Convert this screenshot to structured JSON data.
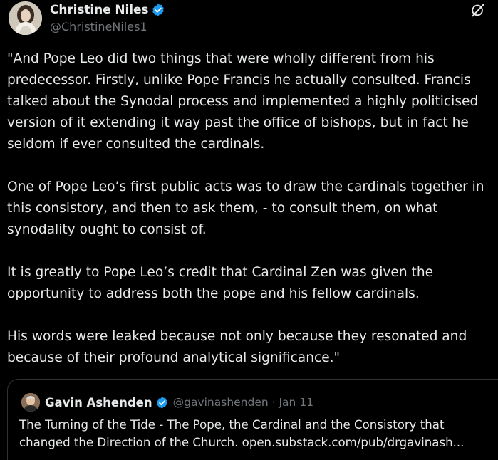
{
  "author": {
    "display_name": "Christine Niles",
    "handle": "@ChristineNiles1",
    "verified_icon": "verified-badge-icon",
    "avatar_icon": "avatar"
  },
  "toolbar": {
    "grok_icon": "grok-icon"
  },
  "tweet": {
    "text": "\"And Pope Leo did two things that were wholly different from his predecessor. Firstly, unlike Pope Francis he actually consulted. Francis talked about the Synodal process and implemented a highly politicised version of it extending it way past the office of bishops, but in fact he seldom if ever consulted the cardinals.\n\nOne of Pope Leo’s first public acts was to draw the cardinals together in this consistory, and then to ask them, - to consult them, on what synodality ought to consist of.\n\nIt is greatly to Pope Leo’s credit that Cardinal Zen was given the opportunity to address both the pope and his fellow cardinals.\n\nHis words were leaked because not only because they resonated and because of their profound analytical significance.\""
  },
  "quoted_tweet": {
    "display_name": "Gavin Ashenden",
    "handle_and_date": "@gavinashenden · Jan 11",
    "line_1": "The Turning of the Tide - The Pope, the Cardinal and the Consistory that",
    "line_2": "changed the Direction of the Church. open.substack.com/pub/drgavinash..."
  },
  "colors": {
    "background": "#000000",
    "text_primary": "#e7e9ea",
    "text_secondary": "#71767b",
    "verified_blue": "#1d9bf0",
    "border": "#2f3336"
  }
}
